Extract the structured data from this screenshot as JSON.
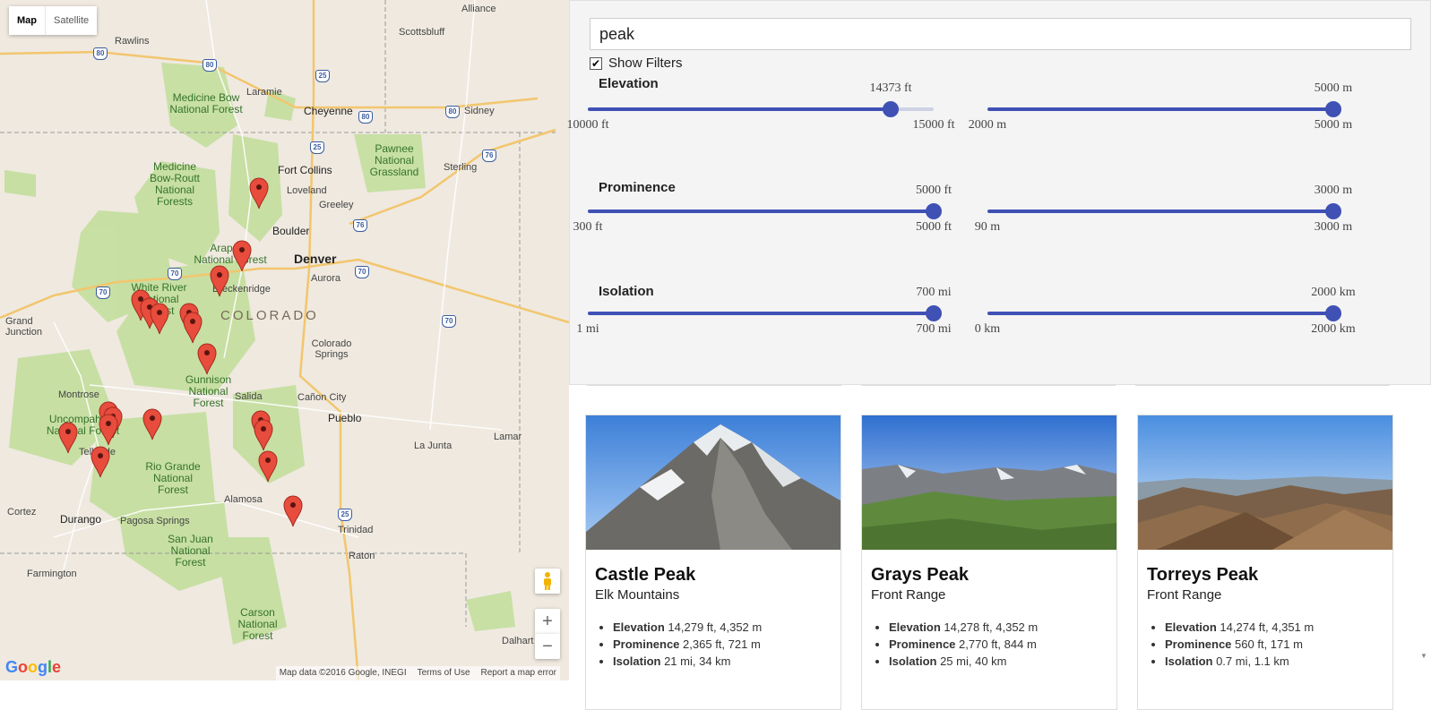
{
  "map": {
    "type_buttons": {
      "map": "Map",
      "satellite": "Satellite"
    },
    "controls": {
      "zoom_in": "+",
      "zoom_out": "−"
    },
    "footer": {
      "data": "Map data ©2016 Google, INEGI",
      "terms": "Terms of Use",
      "report": "Report a map error"
    },
    "logo": "Google",
    "state_label": "COLORADO",
    "cities": [
      {
        "text": "Alliance"
      },
      {
        "text": "Rawlins"
      },
      {
        "text": "Scottsbluff"
      },
      {
        "text": "Laramie"
      },
      {
        "text": "Cheyenne"
      },
      {
        "text": "Sidney"
      },
      {
        "text": "Fort Collins"
      },
      {
        "text": "Sterling"
      },
      {
        "text": "Loveland"
      },
      {
        "text": "Greeley"
      },
      {
        "text": "Boulder"
      },
      {
        "text": "Denver"
      },
      {
        "text": "Aurora"
      },
      {
        "text": "Breckenridge"
      },
      {
        "text": "Grand Junction"
      },
      {
        "text": "Colorado Springs"
      },
      {
        "text": "Montrose"
      },
      {
        "text": "Salida"
      },
      {
        "text": "Cañon City"
      },
      {
        "text": "Pueblo"
      },
      {
        "text": "La Junta"
      },
      {
        "text": "Lamar"
      },
      {
        "text": "Telluride"
      },
      {
        "text": "Alamosa"
      },
      {
        "text": "Cortez"
      },
      {
        "text": "Durango"
      },
      {
        "text": "Pagosa Springs"
      },
      {
        "text": "Trinidad"
      },
      {
        "text": "Farmington"
      },
      {
        "text": "Raton"
      },
      {
        "text": "Dalhart"
      }
    ],
    "forests": [
      "Medicine Bow National Forest",
      "Medicine Bow-Routt National Forests",
      "Pawnee National Grassland",
      "Arapaho National Forest",
      "White River National Forest",
      "Gunnison National Forest",
      "Uncompahgre National Forest",
      "Rio Grande National Forest",
      "San Juan National Forest",
      "Carson National Forest"
    ],
    "highways": [
      "80",
      "80",
      "25",
      "80",
      "80",
      "25",
      "76",
      "76",
      "70",
      "70",
      "70",
      "70",
      "25"
    ]
  },
  "search": {
    "value": "peak"
  },
  "filters": {
    "show_filters_label": "Show Filters",
    "show_filters_checked": "✔",
    "groups": [
      {
        "title": "Elevation",
        "imperial": {
          "value": "14373 ft",
          "min": "10000 ft",
          "max": "15000 ft",
          "fraction": 0.8746
        },
        "metric": {
          "value": "5000 m",
          "min": "2000 m",
          "max": "5000 m",
          "fraction": 1.0
        }
      },
      {
        "title": "Prominence",
        "imperial": {
          "value": "5000 ft",
          "min": "300 ft",
          "max": "5000 ft",
          "fraction": 1.0
        },
        "metric": {
          "value": "3000 m",
          "min": "90 m",
          "max": "3000 m",
          "fraction": 1.0
        }
      },
      {
        "title": "Isolation",
        "imperial": {
          "value": "700 mi",
          "min": "1 mi",
          "max": "700 mi",
          "fraction": 1.0
        },
        "metric": {
          "value": "2000 km",
          "min": "0 km",
          "max": "2000 km",
          "fraction": 1.0
        }
      }
    ]
  },
  "peaks": [
    {
      "name": "Castle Peak",
      "range": "Elk Mountains",
      "elevation_label": "Elevation",
      "elevation": "14,279 ft, 4,352 m",
      "prominence_label": "Prominence",
      "prominence": "2,365 ft, 721 m",
      "isolation_label": "Isolation",
      "isolation": "21 mi, 34 km"
    },
    {
      "name": "Grays Peak",
      "range": "Front Range",
      "elevation_label": "Elevation",
      "elevation": "14,278 ft, 4,352 m",
      "prominence_label": "Prominence",
      "prominence": "2,770 ft, 844 m",
      "isolation_label": "Isolation",
      "isolation": "25 mi, 40 km"
    },
    {
      "name": "Torreys Peak",
      "range": "Front Range",
      "elevation_label": "Elevation",
      "elevation": "14,274 ft, 4,351 m",
      "prominence_label": "Prominence",
      "prominence": "560 ft, 171 m",
      "isolation_label": "Isolation",
      "isolation": "0.7 mi, 1.1 km"
    }
  ],
  "colors": {
    "accent": "#3f51b5",
    "marker": "#e74c3c",
    "forest": "#c8dfa5"
  }
}
